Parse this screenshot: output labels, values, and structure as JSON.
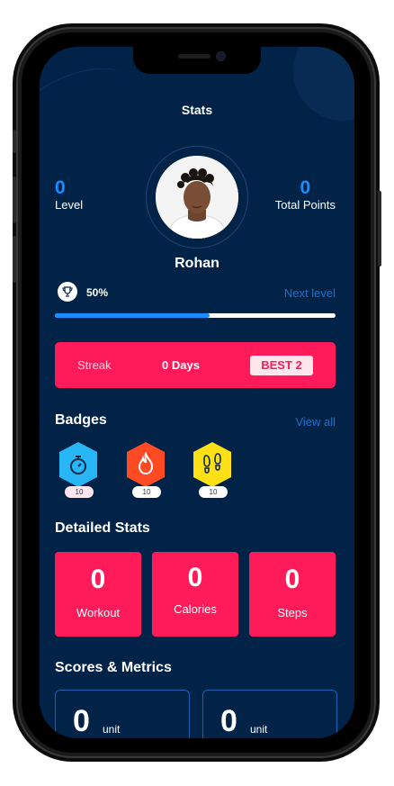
{
  "header": {
    "title": "Stats"
  },
  "profile": {
    "level_value": "0",
    "level_label": "Level",
    "points_value": "0",
    "points_label": "Total Points",
    "name": "Rohan"
  },
  "progress": {
    "percent_text": "50%",
    "percent": 0.55,
    "next_label": "Next level"
  },
  "streak": {
    "label": "Streak",
    "days": "0 Days",
    "best": "BEST 2"
  },
  "badges": {
    "title": "Badges",
    "view_all": "View all",
    "items": [
      {
        "icon": "stopwatch-icon",
        "count": "10",
        "color": "#29b6f6"
      },
      {
        "icon": "flame-icon",
        "count": "10",
        "color": "#ff4a24"
      },
      {
        "icon": "footprints-icon",
        "count": "10",
        "color": "#ffe017"
      }
    ]
  },
  "detailed": {
    "title": "Detailed Stats",
    "cards": [
      {
        "value": "0",
        "label": "Workout"
      },
      {
        "value": "0",
        "label": "Calories"
      },
      {
        "value": "0",
        "label": "Steps"
      }
    ]
  },
  "scores": {
    "title": "Scores & Metrics",
    "metrics": [
      {
        "value": "0",
        "unit": "unit"
      },
      {
        "value": "0",
        "unit": "unit"
      }
    ]
  },
  "colors": {
    "background": "#022348",
    "accent": "#1a8cff",
    "pink": "#ff1a59"
  }
}
